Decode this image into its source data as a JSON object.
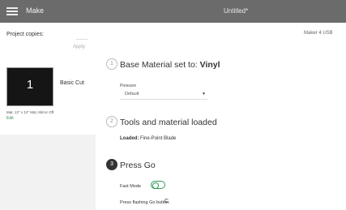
{
  "header": {
    "app_title": "Make",
    "doc_title": "Untitled*"
  },
  "sidebar": {
    "project_copies_label": "Project copies:",
    "apply_label": "Apply",
    "mat": {
      "number": "1",
      "name": "Basic Cut",
      "meta": "Mat, 12\" x 12\" Mat, Mirror Off",
      "edit_label": "Edit"
    }
  },
  "machine_label": "Maker 4 USB",
  "steps": {
    "step1": {
      "number": "1",
      "title_prefix": "Base Material set to:",
      "material": "Vinyl"
    },
    "pressure": {
      "label": "Pressure",
      "value": "Default"
    },
    "step2": {
      "number": "2",
      "title": "Tools and material loaded",
      "loaded_label": "Loaded:",
      "loaded_value": "Fine-Point Blade"
    },
    "step3": {
      "number": "3",
      "title": "Press Go",
      "fast_mode_label": "Fast Mode",
      "fast_mode_on": true,
      "instruction": "Press flashing Go button.",
      "instruction_icon": "C"
    }
  },
  "colors": {
    "topbar": "#6b6b6b",
    "accent": "#2e9a5a"
  }
}
